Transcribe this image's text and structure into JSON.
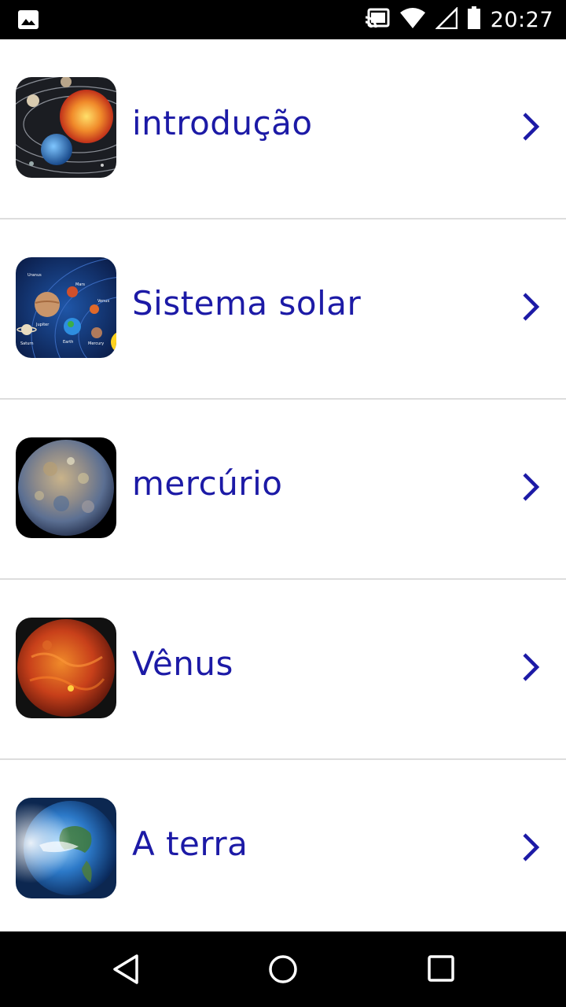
{
  "status_bar": {
    "time": "20:27",
    "icons": [
      "image-notification-icon",
      "cast-icon",
      "wifi-icon",
      "cell-signal-icon",
      "battery-icon"
    ]
  },
  "list": {
    "items": [
      {
        "label": "introdução",
        "thumbnail": "solar-system-orbits-image"
      },
      {
        "label": "Sistema solar",
        "thumbnail": "planets-diagram-image"
      },
      {
        "label": "mercúrio",
        "thumbnail": "mercury-planet-image"
      },
      {
        "label": "Vênus",
        "thumbnail": "venus-planet-image"
      },
      {
        "label": "A terra",
        "thumbnail": "earth-planet-image"
      }
    ],
    "accent_color": "#1c1aa6",
    "chevron_icon": "chevron-right-icon"
  },
  "nav_bar": {
    "buttons": [
      "back-triangle-icon",
      "home-circle-icon",
      "recents-square-icon"
    ]
  },
  "planet_diagram_labels": [
    "Uranus",
    "Mars",
    "Venus",
    "Jupiter",
    "Saturn",
    "Earth",
    "Mercury"
  ]
}
